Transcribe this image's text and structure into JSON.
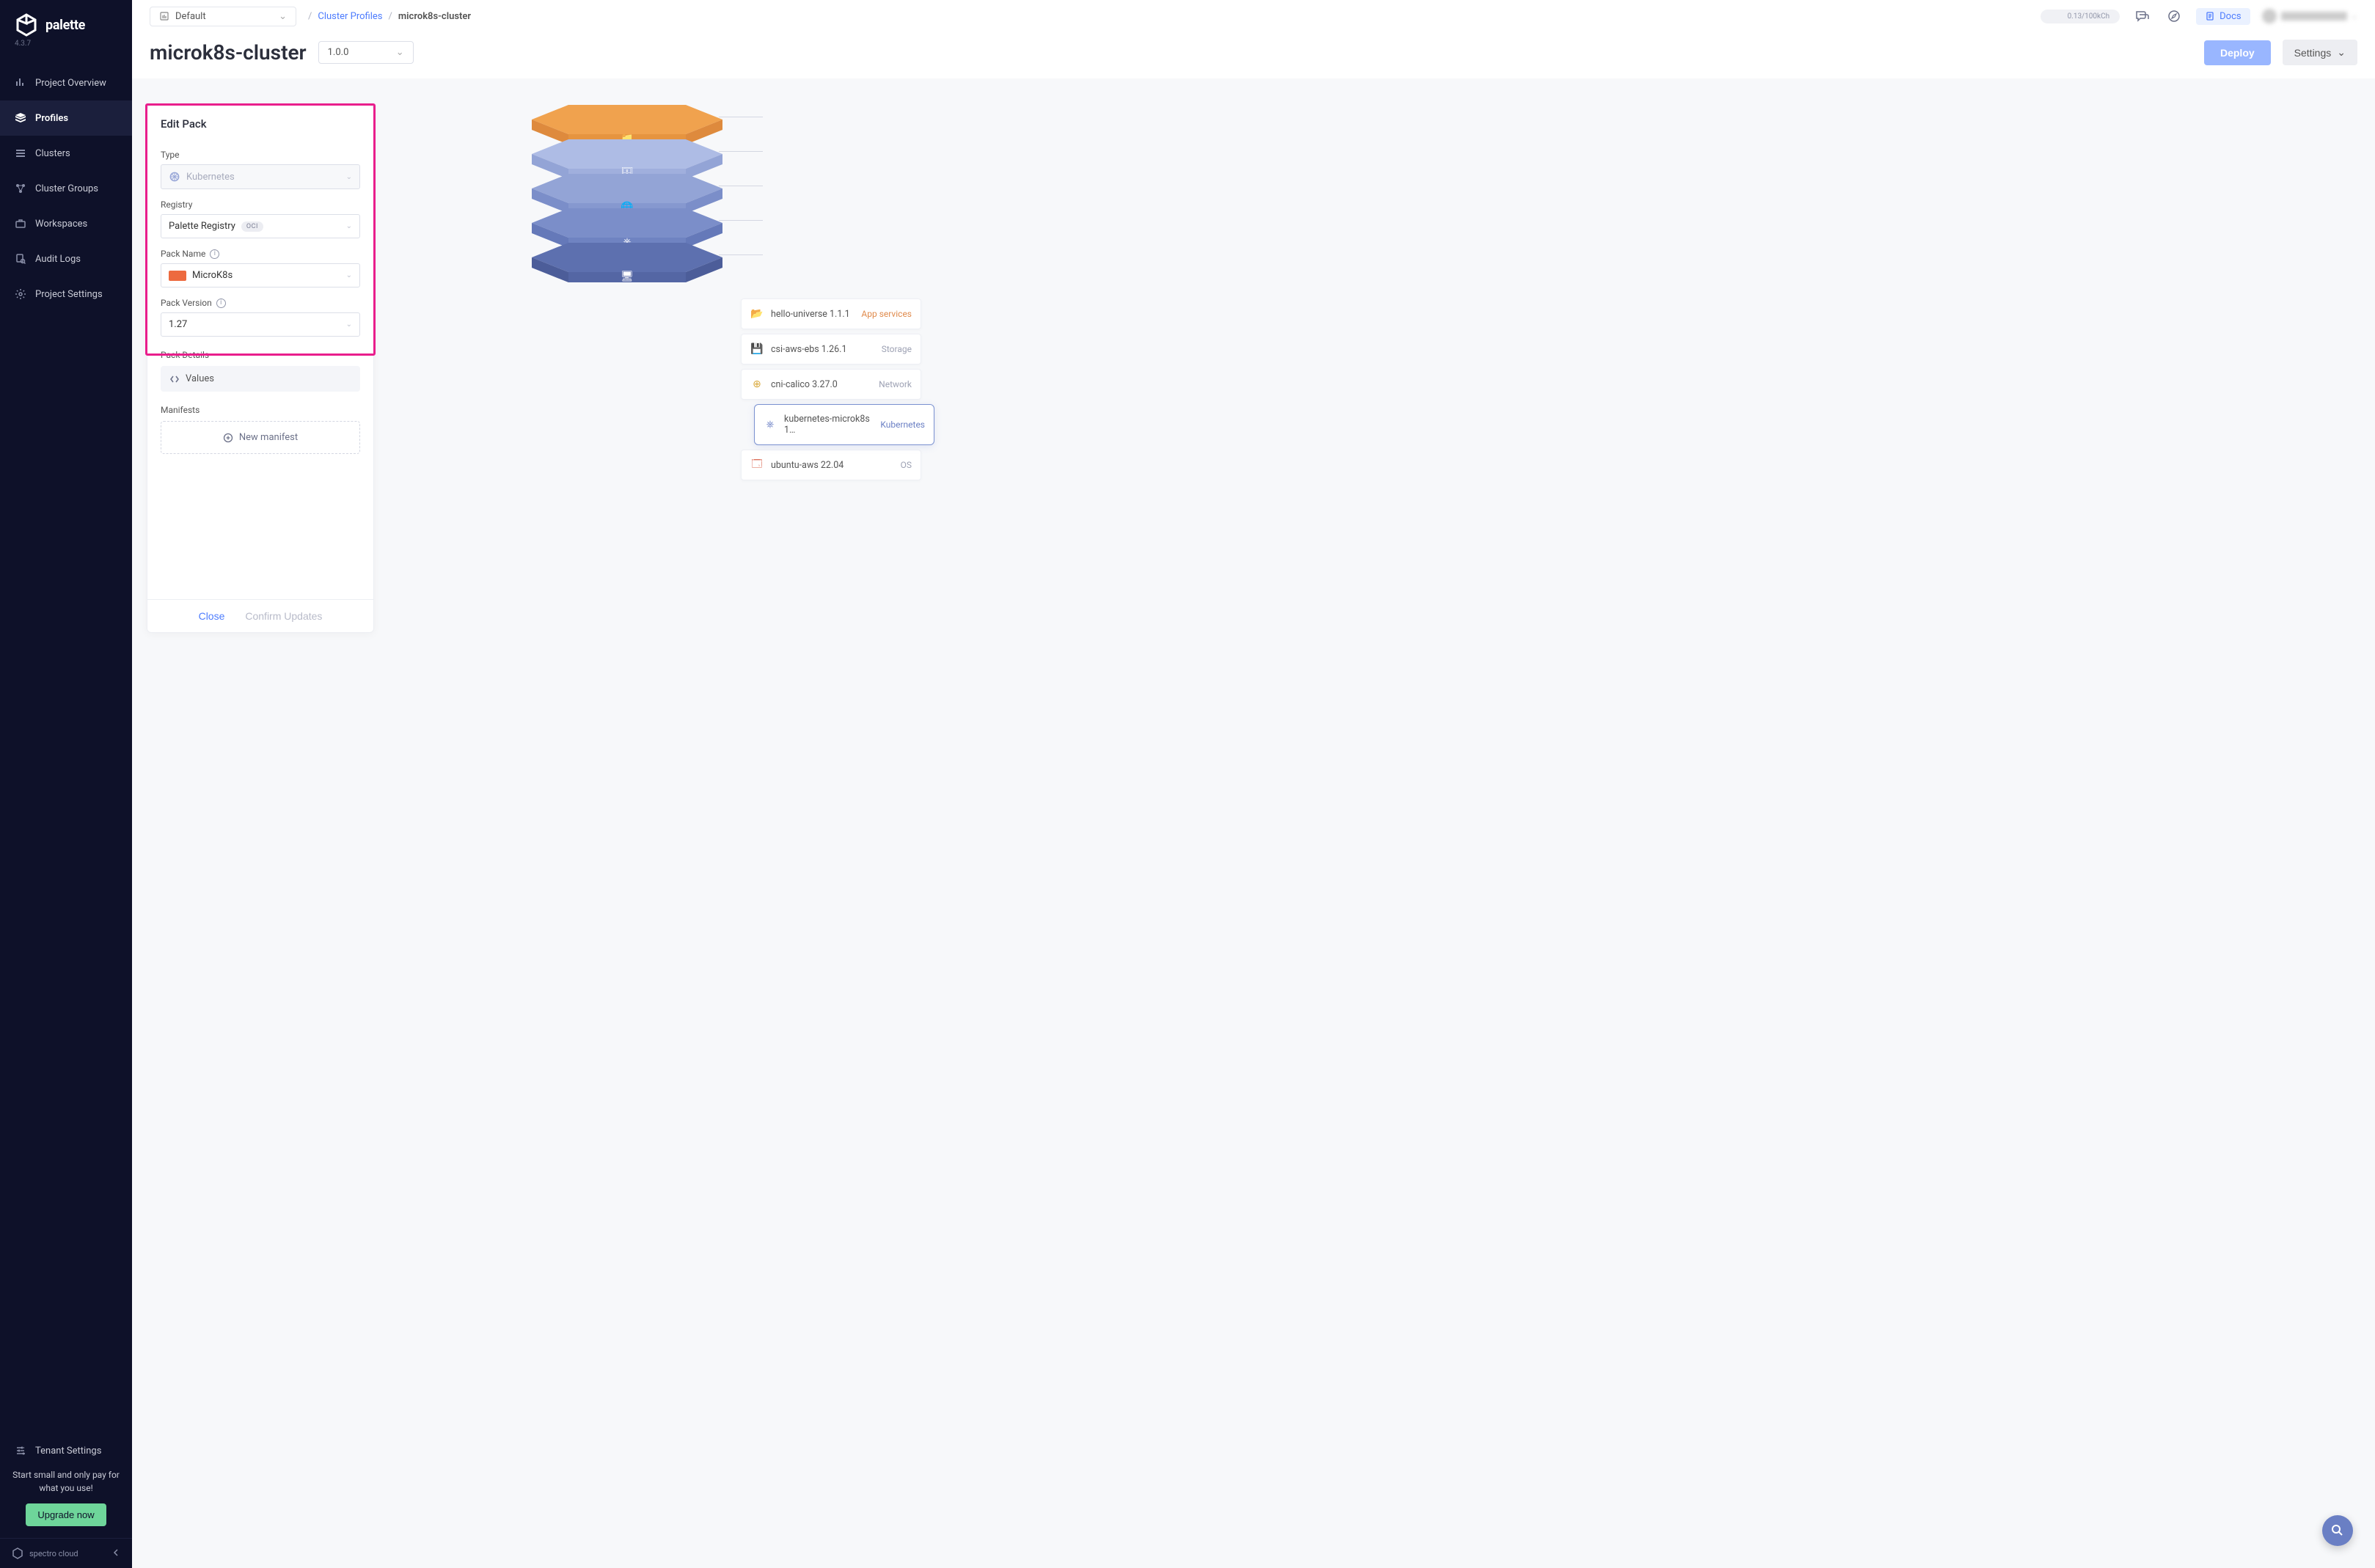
{
  "brand": {
    "name": "palette",
    "version": "4.3.7",
    "footer": "spectro cloud"
  },
  "sidebar": {
    "items": [
      {
        "label": "Project Overview"
      },
      {
        "label": "Profiles"
      },
      {
        "label": "Clusters"
      },
      {
        "label": "Cluster Groups"
      },
      {
        "label": "Workspaces"
      },
      {
        "label": "Audit Logs"
      },
      {
        "label": "Project Settings"
      }
    ],
    "tenant": "Tenant Settings",
    "promo": "Start small and only pay for what you use!",
    "upgrade": "Upgrade now"
  },
  "topbar": {
    "scope": "Default",
    "crumb_link": "Cluster Profiles",
    "crumb_current": "microk8s-cluster",
    "usage": "0.13/100kCh",
    "docs": "Docs"
  },
  "titlebar": {
    "title": "microk8s-cluster",
    "version": "1.0.0",
    "deploy": "Deploy",
    "settings": "Settings"
  },
  "panel": {
    "title": "Edit Pack",
    "type_label": "Type",
    "type_value": "Kubernetes",
    "registry_label": "Registry",
    "registry_value": "Palette Registry",
    "registry_tag": "OCI",
    "name_label": "Pack Name",
    "name_value": "MicroK8s",
    "pver_label": "Pack Version",
    "pver_value": "1.27",
    "details_label": "Pack Details",
    "values_label": "Values",
    "manifests_label": "Manifests",
    "new_manifest": "New manifest",
    "close": "Close",
    "confirm": "Confirm Updates"
  },
  "layers": [
    {
      "name": "hello-universe 1.1.1",
      "kind": "App services",
      "color": "orange"
    },
    {
      "name": "csi-aws-ebs 1.26.1",
      "kind": "Storage",
      "color": "teal"
    },
    {
      "name": "cni-calico 3.27.0",
      "kind": "Network",
      "color": "yellow"
    },
    {
      "name": "kubernetes-microk8s 1…",
      "kind": "Kubernetes",
      "color": "blue",
      "selected": true
    },
    {
      "name": "ubuntu-aws 22.04",
      "kind": "OS",
      "color": "red"
    }
  ],
  "hex_colors": {
    "l0_top": "#f0a24e",
    "l0_side": "#de8a3d",
    "l1_top": "#aebce5",
    "l1_side": "#93a4d6",
    "l2_top": "#93a4d6",
    "l2_side": "#7b8ec9",
    "l3_top": "#7b8ec9",
    "l3_side": "#6579b9",
    "l4_top": "#5d70af",
    "l4_side": "#4c5d99"
  }
}
